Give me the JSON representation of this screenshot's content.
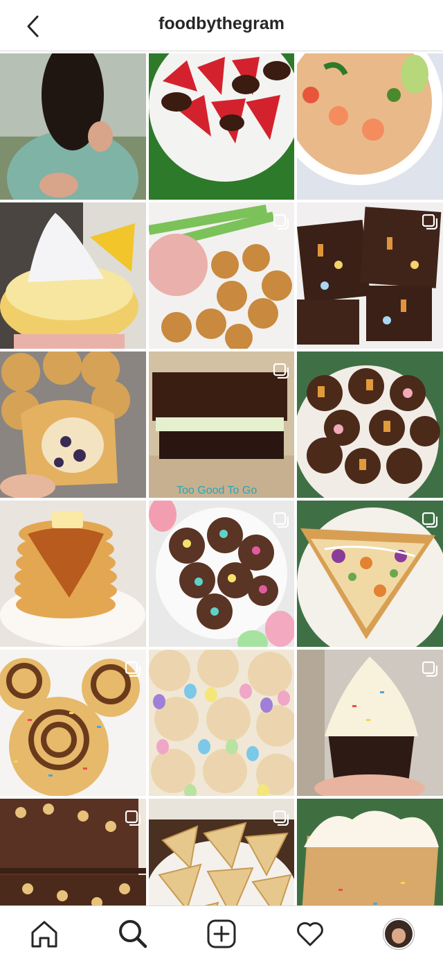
{
  "header": {
    "title": "foodbythegram",
    "back_icon": "chevron-left-icon"
  },
  "grid": {
    "rows": [
      [
        {
          "name": "post-woman-portrait",
          "multi": false
        },
        {
          "name": "post-chocolate-strawberries",
          "multi": false
        },
        {
          "name": "post-shrimp-soup",
          "multi": false
        }
      ],
      [
        {
          "name": "post-lemon-meringue-cupcake",
          "multi": false
        },
        {
          "name": "post-chicken-nuggets-dip",
          "multi": true
        },
        {
          "name": "post-easter-brownies",
          "multi": true
        }
      ],
      [
        {
          "name": "post-blueberry-muffins",
          "multi": false
        },
        {
          "name": "post-mint-brownie-bar",
          "multi": true
        },
        {
          "name": "post-peanut-butter-cups",
          "multi": false
        }
      ],
      [
        {
          "name": "post-waffle-stack",
          "multi": false
        },
        {
          "name": "post-easter-nests",
          "multi": true
        },
        {
          "name": "post-pizza-slice",
          "multi": true
        }
      ],
      [
        {
          "name": "post-cinnamon-rolls",
          "multi": true
        },
        {
          "name": "post-funfetti-cookies",
          "multi": false
        },
        {
          "name": "post-frosted-cupcake",
          "multi": true
        }
      ],
      [
        {
          "name": "post-brownie-blondies",
          "multi": true
        },
        {
          "name": "post-wonton-chips",
          "multi": true
        },
        {
          "name": "post-frosted-blondie",
          "multi": false
        }
      ]
    ]
  },
  "bottom_nav": {
    "items": [
      "home-icon",
      "search-icon",
      "new-post-icon",
      "activity-heart-icon",
      "profile-avatar"
    ]
  }
}
